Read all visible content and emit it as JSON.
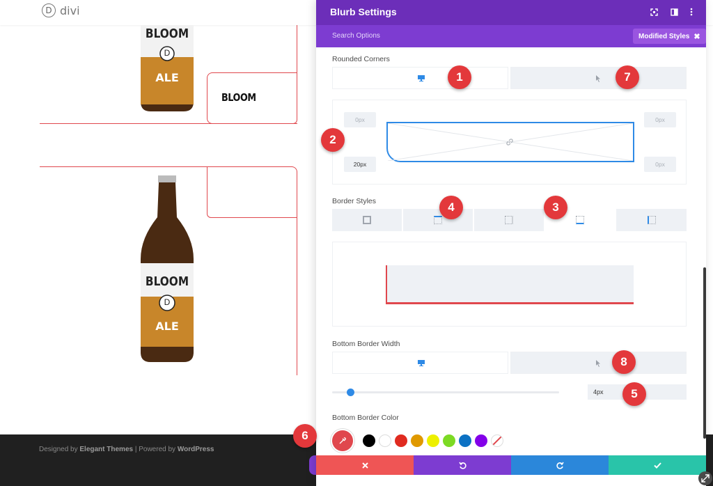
{
  "site": {
    "logo_letter": "D",
    "logo_text": "divi",
    "bloom_label": "BLOOM",
    "bottle_brand": "BLOOM",
    "bottle_letter": "D",
    "bottle_type": "ALE"
  },
  "footer": {
    "prefix": "Designed by ",
    "elegant": "Elegant Themes",
    "sep": " | Powered by ",
    "wp": "WordPress"
  },
  "panel": {
    "title": "Blurb Settings",
    "search_placeholder": "Search Options",
    "modified_styles": "Modified Styles",
    "sections": {
      "rounded_corners": "Rounded Corners",
      "border_styles": "Border Styles",
      "bottom_border_width": "Bottom Border Width",
      "bottom_border_color": "Bottom Border Color"
    },
    "corners": {
      "top_left": "0px",
      "top_right": "0px",
      "bottom_left": "20px",
      "bottom_right": "0px"
    },
    "bottom_border_width_value": "4px",
    "bottom_border_width_slider": 0.08,
    "swatches": [
      "#000000",
      "#ffffff",
      "#e02b20",
      "#e09900",
      "#edf000",
      "#7cda24",
      "#0c71c3",
      "#8300e9"
    ],
    "accent": "#2e8ae6",
    "header_color": "#6c2eb9",
    "footer_buttons": {
      "cancel_color": "#ef5555",
      "undo_color": "#7d3cd1",
      "redo_color": "#2b87da",
      "save_color": "#29c4a9"
    }
  },
  "markers": [
    "1",
    "2",
    "3",
    "4",
    "5",
    "6",
    "7",
    "8"
  ]
}
